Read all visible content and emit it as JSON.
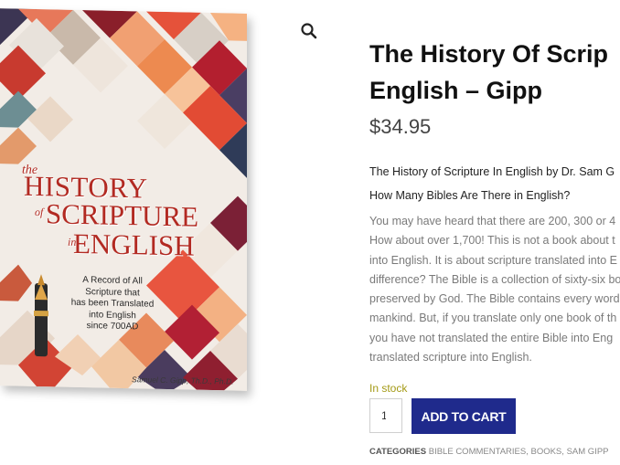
{
  "product": {
    "title_line1": "The History Of Scrip",
    "title_line2": "English – Gipp",
    "price": "$34.95",
    "description_heading": "The History of Scripture In English by Dr. Sam G",
    "description_subheading": "How Many Bibles Are There in English?",
    "description_lines": [
      "You may have heard that there are 200, 300 or 4",
      "How about over 1,700! This is not a book about t",
      "into English. It is about scripture translated into E",
      "difference? The Bible is a collection of sixty-six bo",
      "preserved by God. The Bible contains every word",
      "mankind. But, if you translate only one book of th",
      "you have not translated the entire Bible into Eng",
      "translated scripture into English."
    ],
    "stock_status": "In stock",
    "quantity": "1",
    "add_to_cart_label": "ADD TO CART",
    "categories_label": "CATEGORIES",
    "categories": [
      "BIBLE COMMENTARIES",
      "BOOKS",
      "SAM GIPP"
    ]
  },
  "book_cover": {
    "title_the": "the",
    "title_history": "HISTORY",
    "title_of": "of",
    "title_scripture": "SCRIPTURE",
    "title_in": "in",
    "title_english": "ENGLISH",
    "subtitle_lines": [
      "A Record of All",
      "Scripture that",
      "has been Translated",
      "into English",
      "since 700AD"
    ],
    "author": "Samuel C. Gipp, Th.D., Ph.D."
  },
  "icons": {
    "zoom": "magnifier-icon",
    "pen": "fountain-pen-icon"
  },
  "colors": {
    "button_bg": "#1f2a8c",
    "stock_text": "#a49a16",
    "cover_title": "#b22a22"
  }
}
